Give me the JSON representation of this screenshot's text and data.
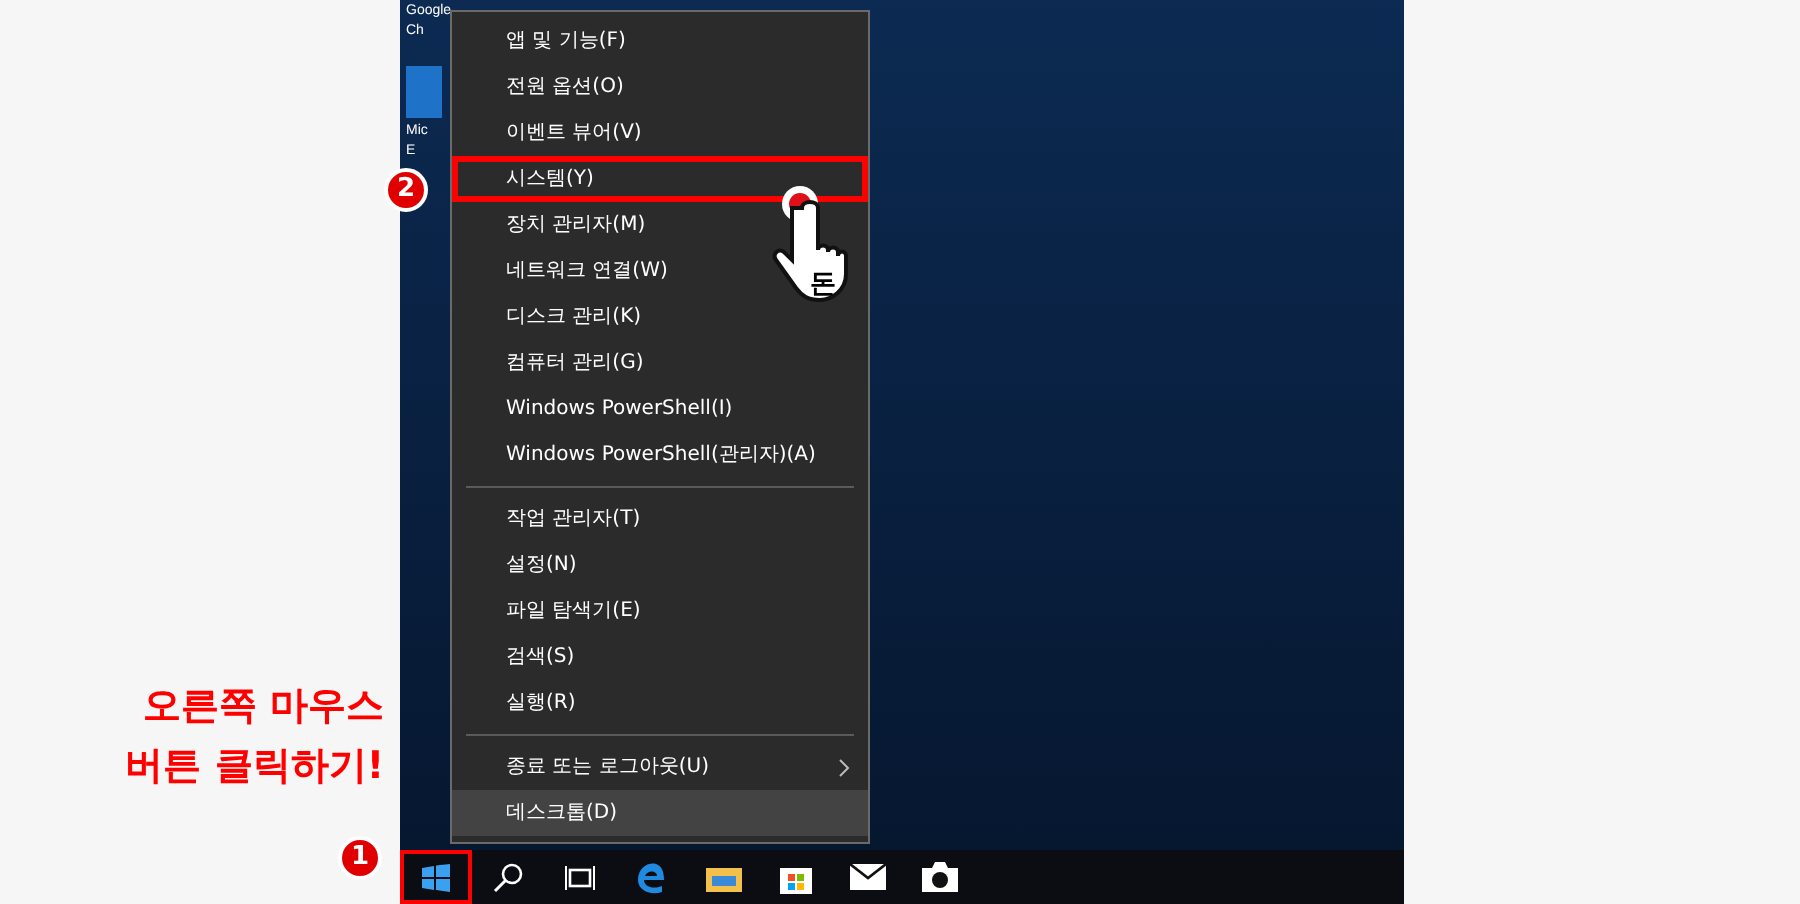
{
  "desktop_icons": [
    {
      "label_lines": [
        "Google",
        "Ch"
      ]
    },
    {
      "label_lines": [
        "Mic",
        "E"
      ]
    }
  ],
  "context_menu": {
    "groups": [
      [
        {
          "label": "앱 및 기능(F)",
          "selected": false,
          "highlighted": false,
          "submenu": false
        },
        {
          "label": "전원 옵션(O)",
          "selected": false,
          "highlighted": false,
          "submenu": false
        },
        {
          "label": "이벤트 뷰어(V)",
          "selected": false,
          "highlighted": false,
          "submenu": false
        },
        {
          "label": "시스템(Y)",
          "selected": false,
          "highlighted": true,
          "submenu": false
        },
        {
          "label": "장치 관리자(M)",
          "selected": false,
          "highlighted": false,
          "submenu": false
        },
        {
          "label": "네트워크 연결(W)",
          "selected": false,
          "highlighted": false,
          "submenu": false
        },
        {
          "label": "디스크 관리(K)",
          "selected": false,
          "highlighted": false,
          "submenu": false
        },
        {
          "label": "컴퓨터 관리(G)",
          "selected": false,
          "highlighted": false,
          "submenu": false
        },
        {
          "label": "Windows PowerShell(I)",
          "selected": false,
          "highlighted": false,
          "submenu": false
        },
        {
          "label": "Windows PowerShell(관리자)(A)",
          "selected": false,
          "highlighted": false,
          "submenu": false
        }
      ],
      [
        {
          "label": "작업 관리자(T)",
          "selected": false,
          "highlighted": false,
          "submenu": false
        },
        {
          "label": "설정(N)",
          "selected": false,
          "highlighted": false,
          "submenu": false
        },
        {
          "label": "파일 탐색기(E)",
          "selected": false,
          "highlighted": false,
          "submenu": false
        },
        {
          "label": "검색(S)",
          "selected": false,
          "highlighted": false,
          "submenu": false
        },
        {
          "label": "실행(R)",
          "selected": false,
          "highlighted": false,
          "submenu": false
        }
      ],
      [
        {
          "label": "종료 또는 로그아웃(U)",
          "selected": false,
          "highlighted": false,
          "submenu": true
        },
        {
          "label": "데스크톱(D)",
          "selected": true,
          "highlighted": false,
          "submenu": false
        }
      ]
    ]
  },
  "taskbar": {
    "items": [
      {
        "kind": "start",
        "highlighted": true
      },
      {
        "kind": "search",
        "highlighted": false
      },
      {
        "kind": "taskview",
        "highlighted": false
      },
      {
        "kind": "edge",
        "highlighted": false
      },
      {
        "kind": "explorer",
        "highlighted": false
      },
      {
        "kind": "store",
        "highlighted": false
      },
      {
        "kind": "mail",
        "highlighted": false
      },
      {
        "kind": "camera",
        "highlighted": false
      }
    ]
  },
  "annotations": {
    "instruction_lines": [
      "오른쪽 마우스",
      "버튼 클릭하기!"
    ],
    "step_badges": [
      "1",
      "2"
    ],
    "cursor_label": "돈"
  }
}
